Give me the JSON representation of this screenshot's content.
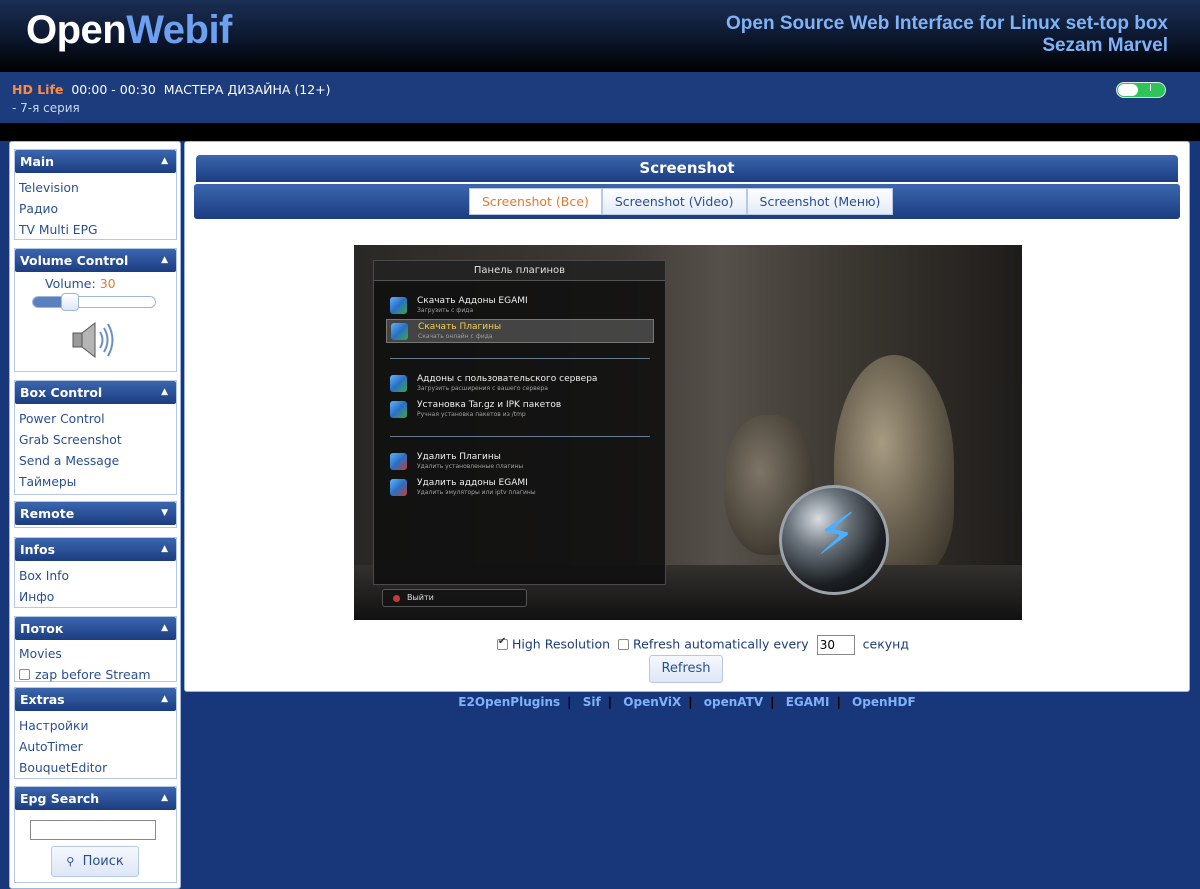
{
  "header": {
    "logo_part1": "Open",
    "logo_part2": "Webif",
    "tagline_line1": "Open Source Web Interface for Linux set-top box",
    "tagline_line2": "Sezam Marvel"
  },
  "now_playing": {
    "channel": "HD Life",
    "time": "00:00 - 00:30",
    "title": "МАСТЕРА ДИЗАЙНА (12+)",
    "subtitle": "- 7-я серия",
    "toggle_on": true,
    "toggle_mark": "I"
  },
  "sidebar": {
    "main": {
      "title": "Main",
      "items": [
        "Television",
        "Радио",
        "TV Multi EPG"
      ]
    },
    "volume": {
      "title": "Volume Control",
      "label": "Volume:",
      "value": "30",
      "level": 0.3
    },
    "box_control": {
      "title": "Box Control",
      "items": [
        "Power Control",
        "Grab Screenshot",
        "Send a Message",
        "Таймеры"
      ]
    },
    "remote": {
      "title": "Remote"
    },
    "infos": {
      "title": "Infos",
      "items": [
        "Box Info",
        "Инфо"
      ]
    },
    "stream": {
      "title": "Поток",
      "items": [
        "Movies"
      ],
      "checkbox_label": "zap before Stream"
    },
    "extras": {
      "title": "Extras",
      "items": [
        "Настройки",
        "AutoTimer",
        "BouquetEditor"
      ]
    },
    "epg": {
      "title": "Epg Search",
      "input_value": "",
      "button_label": "Поиск"
    }
  },
  "main": {
    "title": "Screenshot",
    "tabs": [
      "Screenshot (Все)",
      "Screenshot (Video)",
      "Screenshot (Меню)"
    ],
    "active_tab": 0,
    "high_res_label": "High Resolution",
    "refresh_auto_label": "Refresh automatically every",
    "refresh_interval": "30",
    "seconds_label": "секунд",
    "refresh_button": "Refresh"
  },
  "screenshot_osd": {
    "title": "Панель плагинов",
    "items": [
      {
        "name": "Скачать Аддоны EGAMI",
        "desc": "Загрузить с фида"
      },
      {
        "name": "Скачать Плагины",
        "desc": "Скачать онлайн с фида"
      },
      {
        "name": "Аддоны с пользовательского сервера",
        "desc": "Загрузить расширения с вашего сервера"
      },
      {
        "name": "Установка Tar.gz и IPK пакетов",
        "desc": "Ручная установка пакетов из /tmp"
      },
      {
        "name": "Удалить Плагины",
        "desc": "Удалить установленные плагины"
      },
      {
        "name": "Удалить аддоны EGAMI",
        "desc": "Удалить эмуляторы или iptv плагины"
      }
    ],
    "exit_label": "Выйти"
  },
  "footer": {
    "links": [
      "E2OpenPlugins",
      "Sif",
      "OpenViX",
      "openATV",
      "EGAMI",
      "OpenHDF"
    ]
  }
}
